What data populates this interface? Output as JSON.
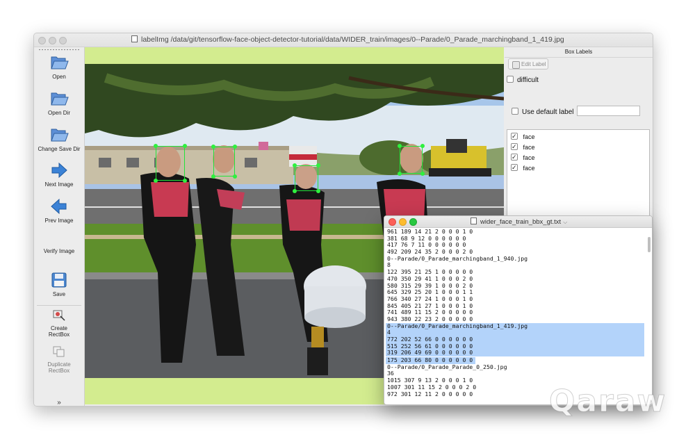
{
  "window": {
    "title": "labelImg /data/git/tensorflow-face-object-detector-tutorial/data/WIDER_train/images/0--Parade/0_Parade_marchingband_1_419.jpg"
  },
  "toolbar": {
    "open": "Open",
    "open_dir": "Open Dir",
    "change_save_dir": "Change Save Dir",
    "next_image": "Next Image",
    "prev_image": "Prev Image",
    "verify_image": "Verify Image",
    "save": "Save",
    "create_rectbox_1": "Create",
    "create_rectbox_2": "RectBox",
    "duplicate_rectbox_1": "Duplicate",
    "duplicate_rectbox_2": "RectBox"
  },
  "panel": {
    "header": "Box Labels",
    "edit_label": "Edit Label",
    "difficult": "difficult",
    "use_default_label": "Use default label",
    "default_label_value": "",
    "labels": [
      {
        "text": "face",
        "checked": true
      },
      {
        "text": "face",
        "checked": true
      },
      {
        "text": "face",
        "checked": true
      },
      {
        "text": "face",
        "checked": true
      }
    ]
  },
  "editor": {
    "title": "wider_face_train_bbx_gt.txt",
    "lines": [
      "961 189 14 21 2 0 0 0 1 0",
      "381 68 9 12 0 0 0 0 0 0",
      "417 76 7 11 0 0 0 0 0 0",
      "492 209 24 35 2 0 0 0 2 0",
      "0--Parade/0_Parade_marchingband_1_940.jpg",
      "8",
      "122 395 21 25 1 0 0 0 0 0",
      "470 350 29 41 1 0 0 0 2 0",
      "580 315 29 39 1 0 0 0 2 0",
      "645 329 25 20 1 0 0 0 1 1",
      "766 340 27 24 1 0 0 0 1 0",
      "845 405 21 27 1 0 0 0 1 0",
      "741 489 11 15 2 0 0 0 0 0",
      "943 380 22 23 2 0 0 0 0 0",
      "0--Parade/0_Parade_marchingband_1_419.jpg",
      "4",
      "772 202 52 66 0 0 0 0 0 0",
      "515 252 56 61 0 0 0 0 0 0",
      "319 206 49 69 0 0 0 0 0 0",
      "175 203 66 80 0 0 0 0 0 0",
      "0--Parade/0_Parade_Parade_0_250.jpg",
      "36",
      "1015 307 9 13 2 0 0 0 1 0",
      "1007 301 11 15 2 0 0 0 2 0",
      "972 301 12 11 2 0 0 0 0 0"
    ],
    "selected_from": 14,
    "selected_to": 19
  },
  "watermark": "Qaraw",
  "colors": {
    "canvas_bg": "#d3ec8f",
    "bbox": "#22e33a",
    "selection": "#b3d3fa"
  }
}
